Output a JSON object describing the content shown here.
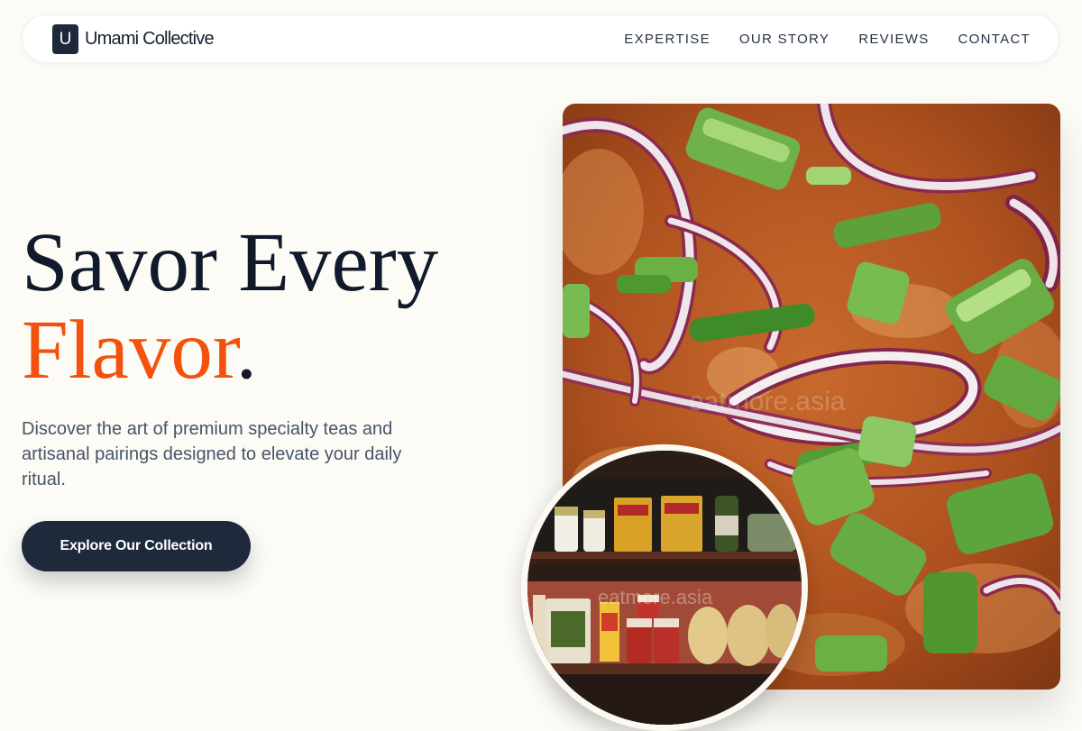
{
  "nav": {
    "logo_letter": "U",
    "brand_name": "Umami Collective",
    "items": [
      {
        "label": "EXPERTISE"
      },
      {
        "label": "OUR STORY"
      },
      {
        "label": "REVIEWS"
      },
      {
        "label": "CONTACT"
      }
    ]
  },
  "hero": {
    "title_line1": "Savor Every",
    "title_accent": "Flavor",
    "title_period": ".",
    "subtitle": "Discover the art of premium specialty teas and artisanal pairings designed to elevate your daily ritual.",
    "cta_label": "Explore Our Collection"
  },
  "images": {
    "main_watermark": "eatmore.asia",
    "circle_watermark": "eatmore.asia"
  },
  "colors": {
    "background": "#fcfbf6",
    "navy": "#1e293b",
    "accent": "#f2520d"
  }
}
